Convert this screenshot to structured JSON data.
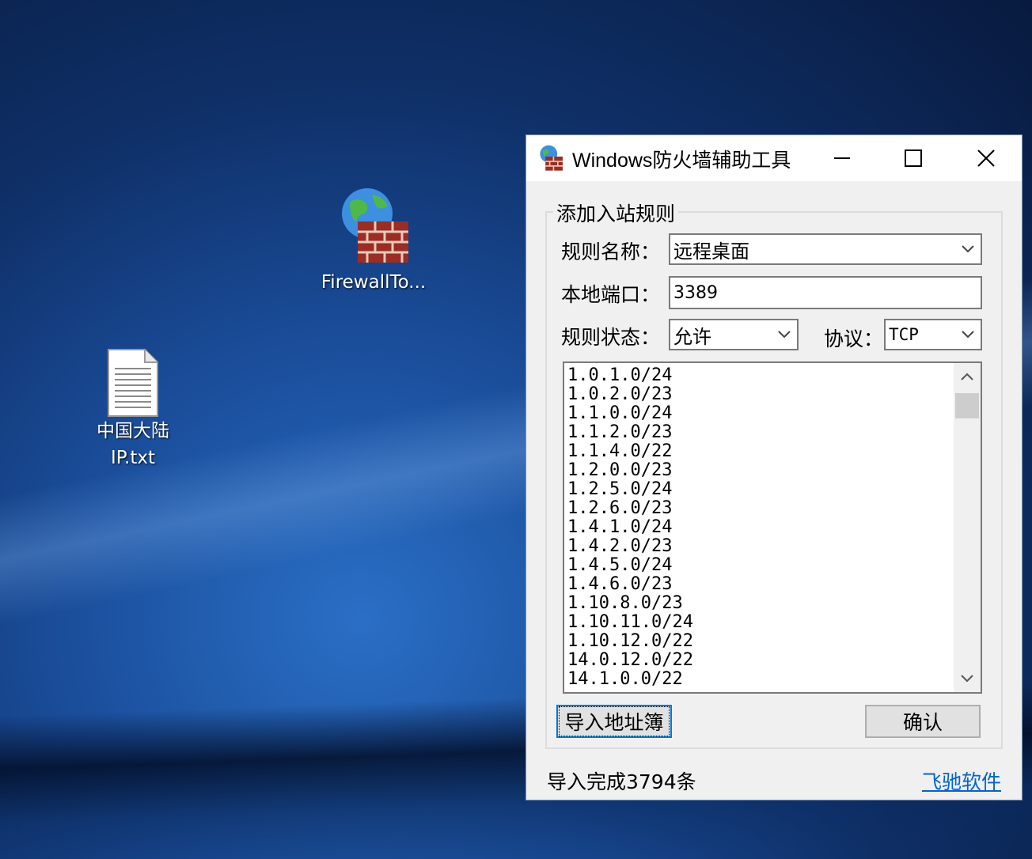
{
  "desktop": {
    "icons": [
      {
        "label": "FirewallTo..."
      },
      {
        "label_line1": "中国大陆",
        "label_line2": "IP.txt"
      }
    ]
  },
  "window": {
    "title": "Windows防火墙辅助工具",
    "group_title": "添加入站规则",
    "rule_name_label": "规则名称：",
    "rule_name_value": "远程桌面",
    "local_port_label": "本地端口：",
    "local_port_value": "3389",
    "rule_state_label": "规则状态：",
    "rule_state_value": "允许",
    "protocol_label": "协议：",
    "protocol_value": "TCP",
    "ip_list": [
      "1.0.1.0/24",
      "1.0.2.0/23",
      "1.1.0.0/24",
      "1.1.2.0/23",
      "1.1.4.0/22",
      "1.2.0.0/23",
      "1.2.5.0/24",
      "1.2.6.0/23",
      "1.4.1.0/24",
      "1.4.2.0/23",
      "1.4.5.0/24",
      "1.4.6.0/23",
      "1.10.8.0/23",
      "1.10.11.0/24",
      "1.10.12.0/22",
      "14.0.12.0/22",
      "14.1.0.0/22"
    ],
    "import_button": "导入地址簿",
    "confirm_button": "确认",
    "status_text": "导入完成3794条",
    "link_text": "飞驰软件"
  },
  "icons": {
    "firewall": "firewall-globe-brick-icon",
    "text_file": "text-file-icon",
    "minimize": "minimize-icon",
    "maximize": "maximize-icon",
    "close": "close-icon",
    "dropdown": "chevron-down-icon"
  },
  "colors": {
    "link": "#0066cc",
    "focus_border": "#0078d7",
    "desktop_blue": "#1a4d9a"
  }
}
